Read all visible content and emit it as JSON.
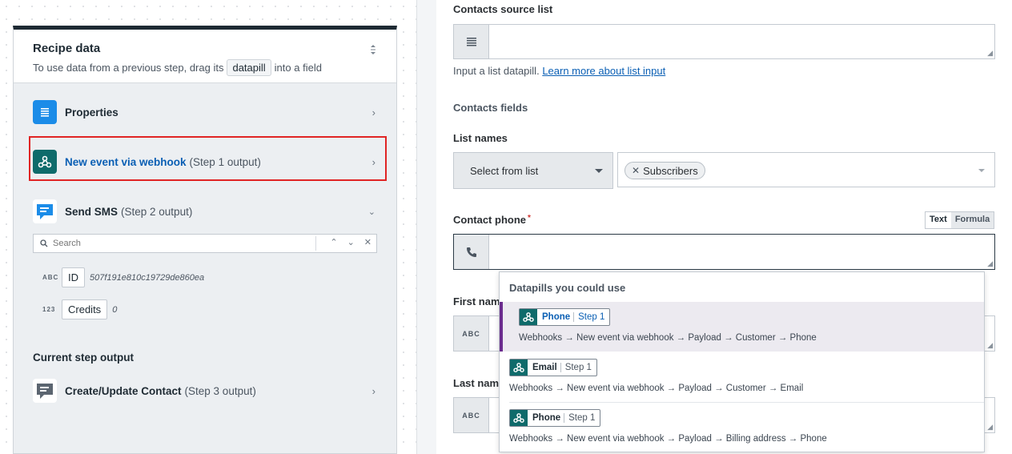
{
  "recipe_data": {
    "title": "Recipe data",
    "subtitle_before": "To use data from a previous step, drag its",
    "subtitle_chip": "datapill",
    "subtitle_after": "into a field",
    "steps": [
      {
        "name": "Properties",
        "suffix": ""
      },
      {
        "name": "New event via webhook",
        "suffix": "(Step 1 output)"
      },
      {
        "name": "Send SMS",
        "suffix": "(Step 2 output)"
      }
    ],
    "search_placeholder": "Search",
    "fields": [
      {
        "type": "ABC",
        "label": "ID",
        "value": "507f191e810c19729de860ea"
      },
      {
        "type": "123",
        "label": "Credits",
        "value": "0"
      }
    ],
    "current_step_label": "Current step output",
    "current_step": {
      "name": "Create/Update Contact",
      "suffix": "(Step 3 output)"
    }
  },
  "form": {
    "contacts_source_list_label": "Contacts source list",
    "contacts_source_hint": "Input a list datapill.",
    "contacts_source_link": "Learn more about list input",
    "contacts_fields_label": "Contacts fields",
    "list_names_label": "List names",
    "select_from_list": "Select from list",
    "tag_subscribers": "Subscribers",
    "contact_phone_label": "Contact phone",
    "toggle_text": "Text",
    "toggle_formula": "Formula",
    "first_name_label": "First nam",
    "last_name_label": "Last nam",
    "prefix_abc": "ABC"
  },
  "datapills": {
    "title": "Datapills you could use",
    "items": [
      {
        "name": "Phone",
        "step": "Step 1",
        "path": "Webhooks → New event via webhook → Payload → Customer → Phone"
      },
      {
        "name": "Email",
        "step": "Step 1",
        "path": "Webhooks → New event via webhook → Payload → Customer → Email"
      },
      {
        "name": "Phone",
        "step": "Step 1",
        "path": "Webhooks → New event via webhook → Payload → Billing address → Phone"
      }
    ]
  },
  "colors": {
    "highlight": "#e02424",
    "link": "#0a5fb4",
    "webhook_teal": "#0f6b6b",
    "properties_blue": "#1b8ce8",
    "active_bar": "#6b2c8e"
  }
}
